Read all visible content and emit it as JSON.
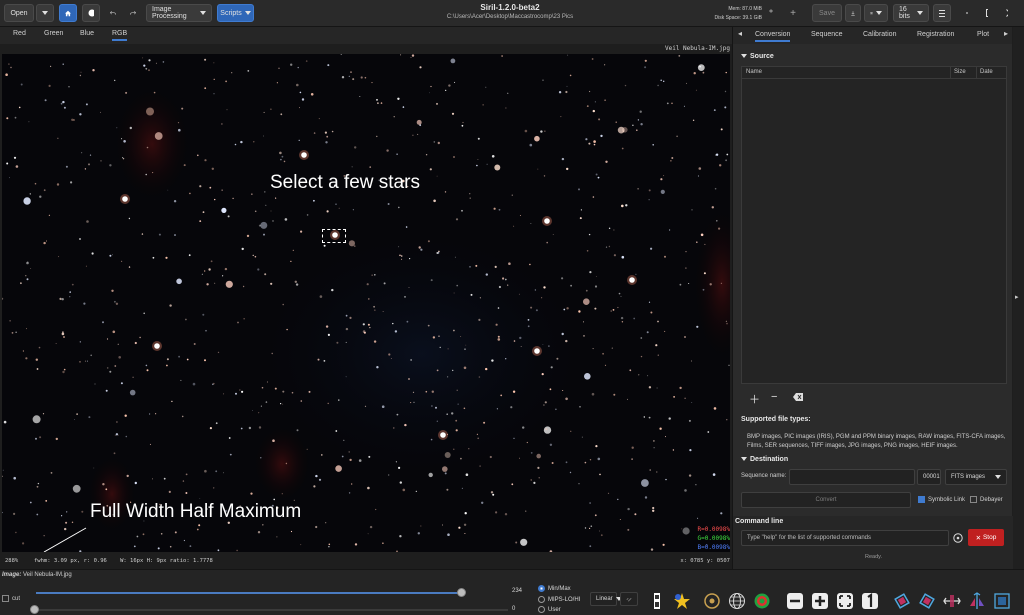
{
  "header": {
    "open_label": "Open",
    "image_processing_label": "Image Processing",
    "scripts_label": "Scripts",
    "app_title": "Siril-1.2.0-beta2",
    "path": "C:\\Users\\Acer\\Desktop\\Maccastrocomp\\23 Pics",
    "mem": "Mem: 87.0 MiB",
    "disk": "Disk Space: 39.1 GiB",
    "save_label": "Save",
    "bits_label": "16 bits"
  },
  "channels": [
    "Red",
    "Green",
    "Blue",
    "RGB"
  ],
  "image_name": "Veil Nebula-IM.jpg",
  "annotations": {
    "select": "Select a few  stars",
    "fwhm": "Full Width Half Maximum"
  },
  "rgb_values": {
    "r": "R=0.0098%",
    "g": "G=0.0098%",
    "b": "B=0.0098%"
  },
  "status": {
    "zoom": "288%",
    "fwhm_text": "fwhm: 3.09 px, r: 0.96    W: 16px H: 9px ratio: 1.7778",
    "coords": "x: 0785 y: 0507"
  },
  "right_tabs": [
    "Conversion",
    "Sequence",
    "Calibration",
    "Registration",
    "Plot"
  ],
  "source": {
    "heading": "Source",
    "col_name": "Name",
    "col_size": "Size",
    "col_date": "Date"
  },
  "supported": {
    "heading": "Supported file types:",
    "text": "BMP images, PIC images (IRIS), PGM and PPM binary images, RAW images, FITS-CFA images, Films, SER sequences, TIFF images, JPG images, PNG images, HEIF images."
  },
  "destination": {
    "heading": "Destination",
    "seq_label": "Sequence name:",
    "index": "00001",
    "format": "FITS images",
    "convert": "Convert",
    "symlink": "Symbolic Link",
    "debayer": "Debayer"
  },
  "command": {
    "heading": "Command line",
    "placeholder": "Type \"help\" for the list of supported commands",
    "stop": "Stop",
    "ready": "Ready."
  },
  "bottom": {
    "image_label": "Image:",
    "image_file": "Veil Nebula-IM.jpg",
    "cut_label": "cut",
    "high_value": "234",
    "low_value": "0",
    "minmax": "Min/Max",
    "mipslo": "MIPS-LO/HI",
    "user": "User",
    "linear": "Linear"
  }
}
